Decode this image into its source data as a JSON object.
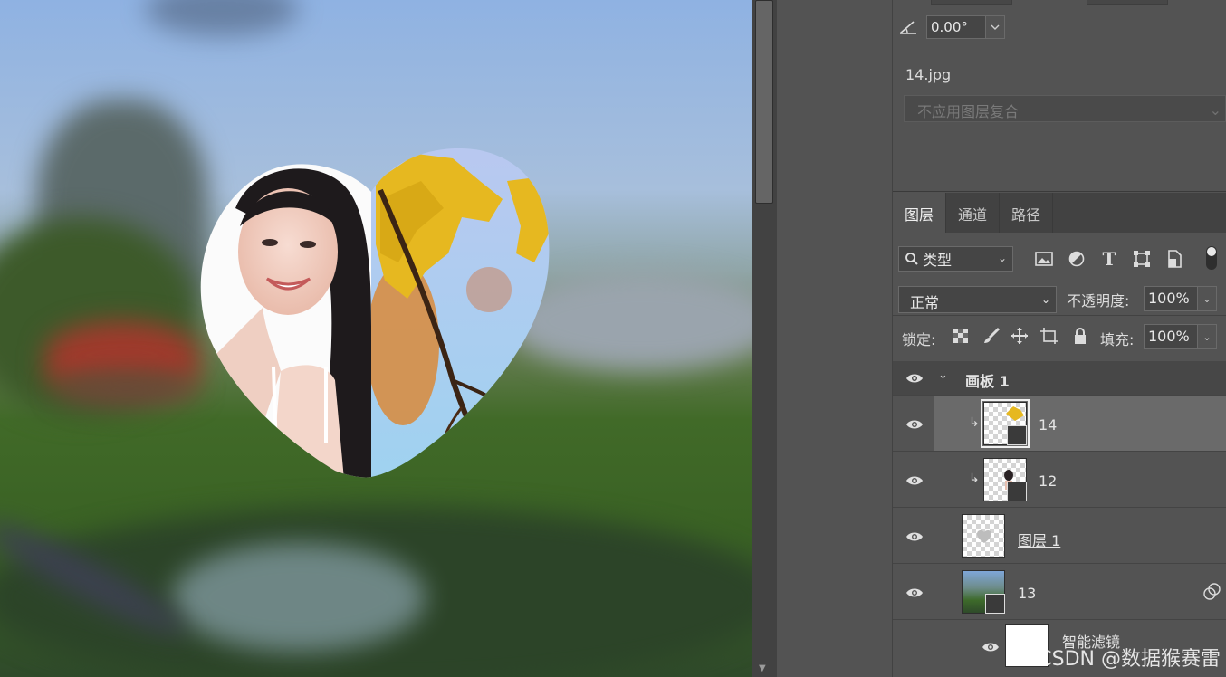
{
  "properties": {
    "angle_value": "0.00°",
    "filename": "14.jpg",
    "layer_comp_placeholder": "不应用图层复合"
  },
  "layers_panel": {
    "tabs": [
      {
        "label": "图层",
        "active": true
      },
      {
        "label": "通道",
        "active": false
      },
      {
        "label": "路径",
        "active": false
      }
    ],
    "filter_kind": "类型",
    "blend_mode": "正常",
    "opacity_label": "不透明度:",
    "opacity_value": "100%",
    "lock_label": "锁定:",
    "fill_label": "填充:",
    "fill_value": "100%",
    "layers": [
      {
        "name": "画板 1",
        "type": "artboard",
        "expanded": true
      },
      {
        "name": "14",
        "type": "smart-object",
        "clipped": true,
        "selected": true
      },
      {
        "name": "12",
        "type": "smart-object",
        "clipped": true
      },
      {
        "name": "图层 1",
        "type": "pixel"
      },
      {
        "name": "13",
        "type": "smart-object",
        "has_smart_filter": true
      },
      {
        "name": "智能滤镜",
        "type": "smart-filter"
      }
    ]
  },
  "watermark": "CSDN @数据猴赛雷",
  "icons": {
    "angle": "angle-icon",
    "search": "search-icon",
    "visibility": "eye-icon"
  }
}
